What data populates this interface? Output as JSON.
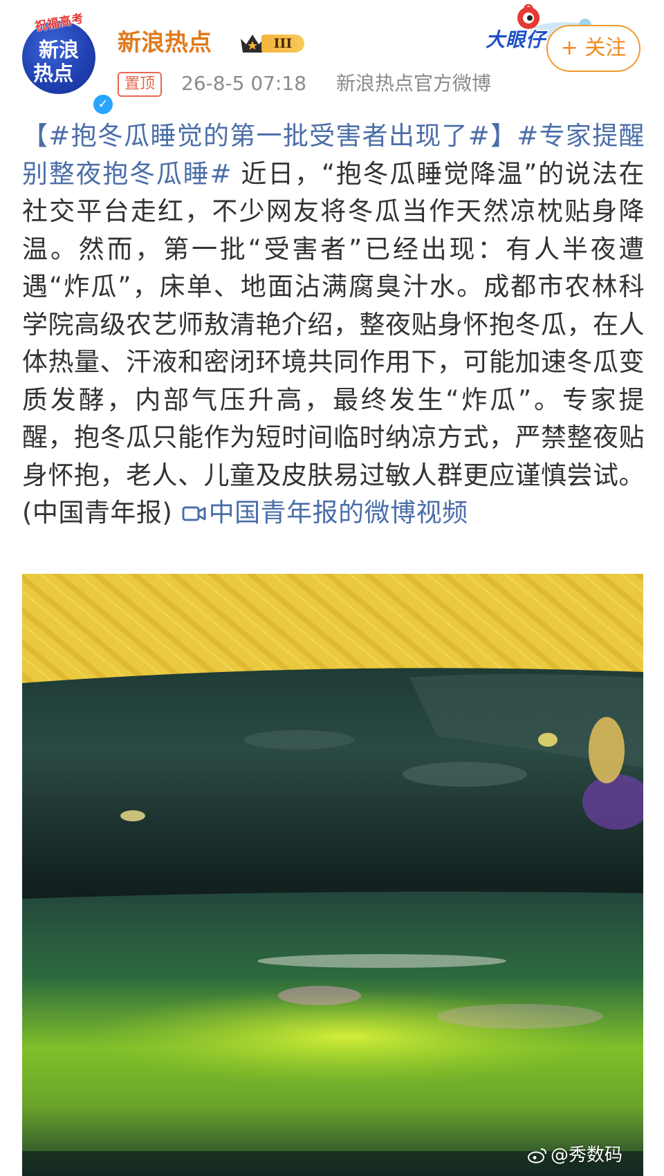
{
  "account": {
    "avatar_ribbon": "祝福高考",
    "avatar_line1": "新浪",
    "avatar_line2": "热点",
    "username": "新浪热点",
    "level": "III",
    "pinned_label": "置顶",
    "timestamp": "26-8-5 07:18",
    "source": "新浪热点官方微博"
  },
  "campaign": {
    "label": "大眼仔"
  },
  "follow": {
    "label": "+ 关注"
  },
  "post": {
    "hashtag1": "【#抱冬瓜睡觉的第一批受害者出现了#】",
    "hashtag2": "#专家提醒别整夜抱冬瓜睡#",
    "body": " 近日，“抱冬瓜睡觉降温”的说法在社交平台走红，不少网友将冬瓜当作天然凉枕贴身降温。然而，第一批“受害者”已经出现：有人半夜遭遇“炸瓜”，床单、地面沾满腐臭汁水。成都市农林科学院高级农艺师敖清艳介绍，整夜贴身怀抱冬瓜，在人体热量、汗液和密闭环境共同作用下，可能加速冬瓜变质发酵，内部气压升高，最终发生“炸瓜”。专家提醒，抱冬瓜只能作为短时间临时纳凉方式，严禁整夜贴身怀抱，老人、儿童及皮肤易过敏人群更应谨慎尝试。(中国青年报) ",
    "video_link": "中国青年报的微博视频"
  },
  "media": {
    "watermark": "@秀数码"
  },
  "colors": {
    "username": "#e07a1c",
    "link": "#4b6ea8",
    "follow_border": "#f39a2c",
    "pin": "#e5674f"
  }
}
